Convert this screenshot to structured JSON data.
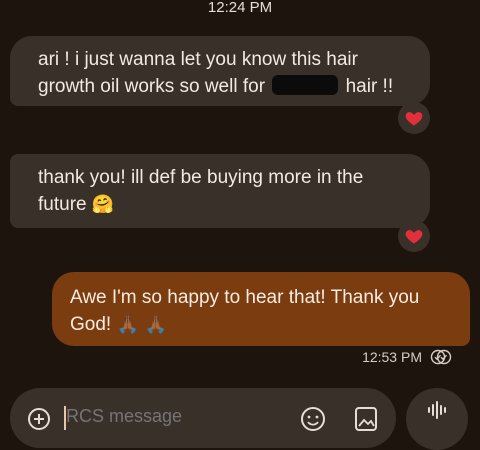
{
  "status_time": "12:24 PM",
  "messages": [
    {
      "direction": "incoming",
      "text_before": "ari ! i just wanna let you know this hair growth oil works so well for",
      "text_after": "hair !!",
      "redacted": true,
      "reaction": "heart"
    },
    {
      "direction": "incoming",
      "text": "thank you! ill def be buying more in the future",
      "emoji": "🤗",
      "reaction": "heart"
    },
    {
      "direction": "outgoing",
      "text": "Awe I'm so happy to hear that! Thank you God!",
      "emoji": "🙏🏾 🙏🏾"
    }
  ],
  "last_sent": {
    "time": "12:53 PM",
    "status_icon": "read-double-check-icon"
  },
  "composer": {
    "placeholder": "RCS message"
  },
  "colors": {
    "background": "#1d140e",
    "incoming_bubble": "#3a302a",
    "outgoing_bubble": "#7b3c10",
    "heart": "#e2303a"
  }
}
